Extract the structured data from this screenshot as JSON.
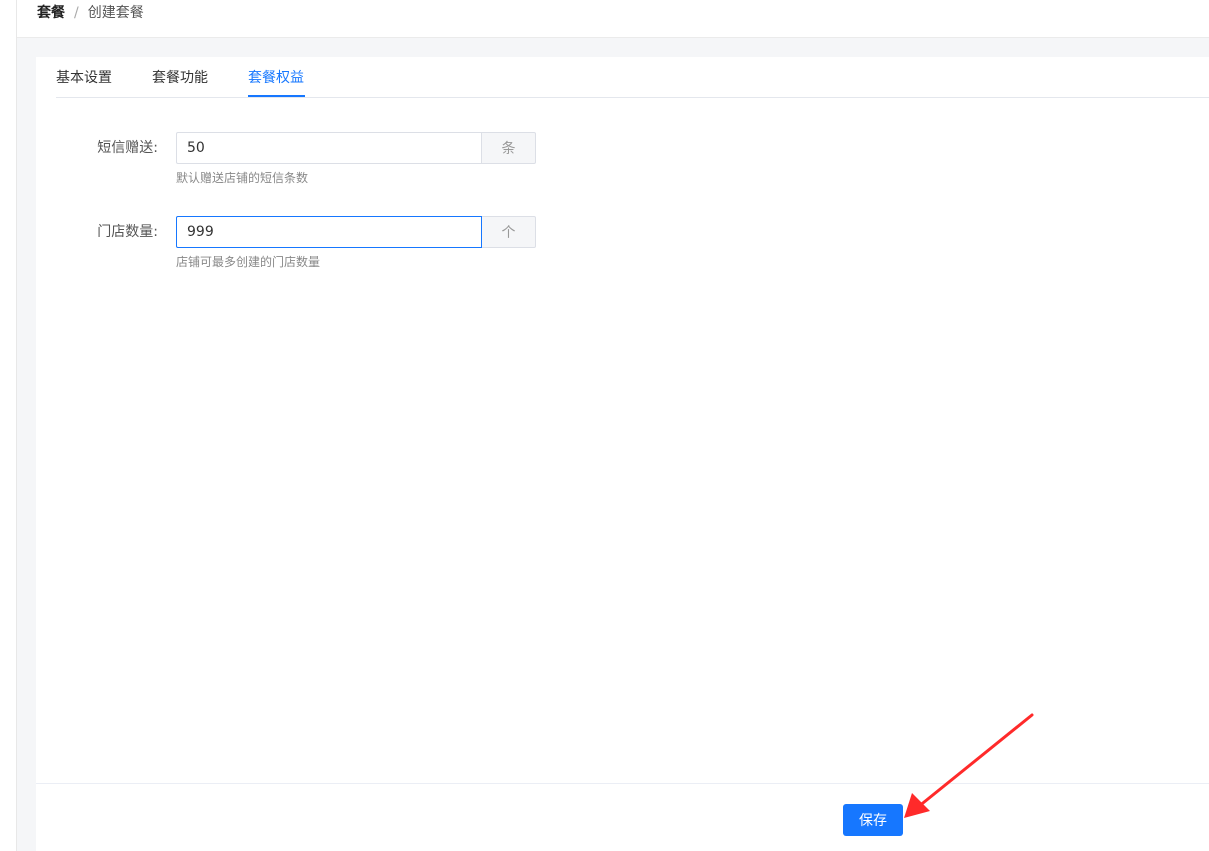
{
  "breadcrumb": {
    "parent": "套餐",
    "separator": "/",
    "current": "创建套餐"
  },
  "tabs": [
    {
      "label": "基本设置",
      "active": false
    },
    {
      "label": "套餐功能",
      "active": false
    },
    {
      "label": "套餐权益",
      "active": true
    }
  ],
  "form": {
    "sms": {
      "label": "短信赠送:",
      "value": "50",
      "unit": "条",
      "hint": "默认赠送店铺的短信条数"
    },
    "stores": {
      "label": "门店数量:",
      "value": "999",
      "unit": "个",
      "hint": "店铺可最多创建的门店数量"
    }
  },
  "footer": {
    "save_label": "保存"
  },
  "colors": {
    "accent": "#1677ff",
    "annotation_arrow": "#ff2a2a"
  }
}
